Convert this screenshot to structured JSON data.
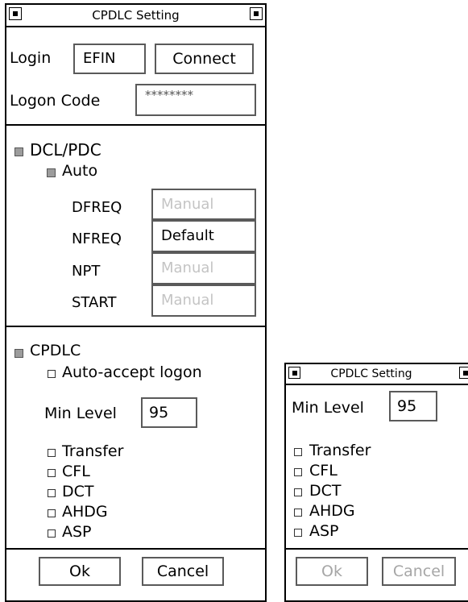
{
  "main": {
    "title": "CPDLC Setting",
    "login": {
      "label": "Login",
      "value": "EFIN",
      "button": "Connect"
    },
    "logon_code": {
      "label": "Logon Code",
      "value": "********"
    },
    "dcl_pdc": {
      "label": "DCL/PDC",
      "auto_label": "Auto",
      "rows": [
        {
          "label": "DFREQ",
          "value": "Manual"
        },
        {
          "label": "NFREQ",
          "value": "Default"
        },
        {
          "label": "NPT",
          "value": "Manual"
        },
        {
          "label": "START",
          "value": "Manual"
        }
      ]
    },
    "cpdlc": {
      "label": "CPDLC",
      "auto_accept_label": "Auto-accept logon",
      "min_level_label": "Min Level",
      "min_level_value": "95",
      "checks": [
        "Transfer",
        "CFL",
        "DCT",
        "AHDG",
        "ASP"
      ]
    },
    "footer": {
      "ok": "Ok",
      "cancel": "Cancel"
    }
  },
  "mini": {
    "title": "CPDLC Setting",
    "min_level_label": "Min Level",
    "min_level_value": "95",
    "checks": [
      "Transfer",
      "CFL",
      "DCT",
      "AHDG",
      "ASP"
    ],
    "footer": {
      "ok": "Ok",
      "cancel": "Cancel"
    }
  }
}
